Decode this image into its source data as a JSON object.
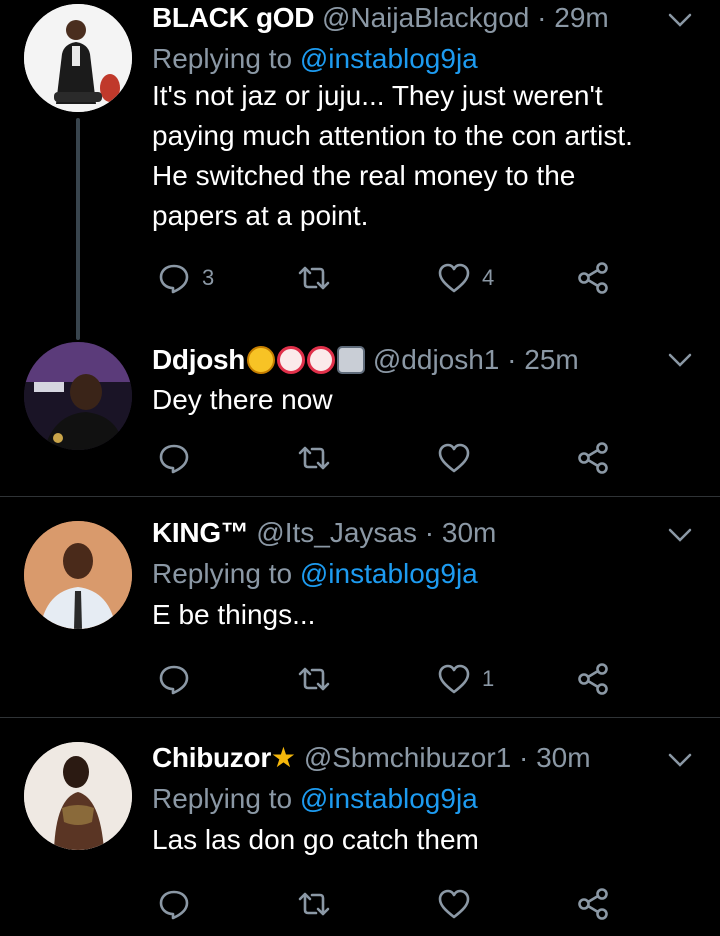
{
  "tweets": [
    {
      "name": "BLACK gOD",
      "handle": "@NaijaBlackgod",
      "time": "29m",
      "replying_prefix": "Replying to ",
      "replying_to": "@instablog9ja",
      "text_lines": [
        "It's not jaz or juju... They just weren't",
        "paying much attention to the con artist.",
        "He switched the real money to the",
        "papers at a point."
      ],
      "reply_count": "3",
      "retweet_count": "",
      "like_count": "4"
    },
    {
      "name": "Ddjosh",
      "name_emojis": [
        "nerd-face-emoji",
        "clown-face-emoji",
        "clown-face-emoji",
        "robot-emoji"
      ],
      "handle": "@ddjosh1",
      "time": "25m",
      "text_lines": [
        "Dey there now"
      ],
      "reply_count": "",
      "retweet_count": "",
      "like_count": ""
    },
    {
      "name": "KING™",
      "handle": "@Its_Jaysas",
      "time": "30m",
      "replying_prefix": "Replying to ",
      "replying_to": "@instablog9ja",
      "text_lines": [
        "E be things..."
      ],
      "reply_count": "",
      "retweet_count": "",
      "like_count": "1"
    },
    {
      "name": "Chibuzor",
      "name_star": "★",
      "handle": "@Sbmchibuzor1",
      "time": "30m",
      "replying_prefix": "Replying to ",
      "replying_to": "@instablog9ja",
      "text_lines": [
        "Las las don go catch them"
      ],
      "reply_count": "",
      "retweet_count": "",
      "like_count": ""
    }
  ],
  "separator": " · ",
  "colors": {
    "background": "#000000",
    "text": "#ffffff",
    "secondary": "#8b98a5",
    "mention": "#1d9bf0",
    "divider": "#2f3336",
    "star": "#f5b70b"
  }
}
